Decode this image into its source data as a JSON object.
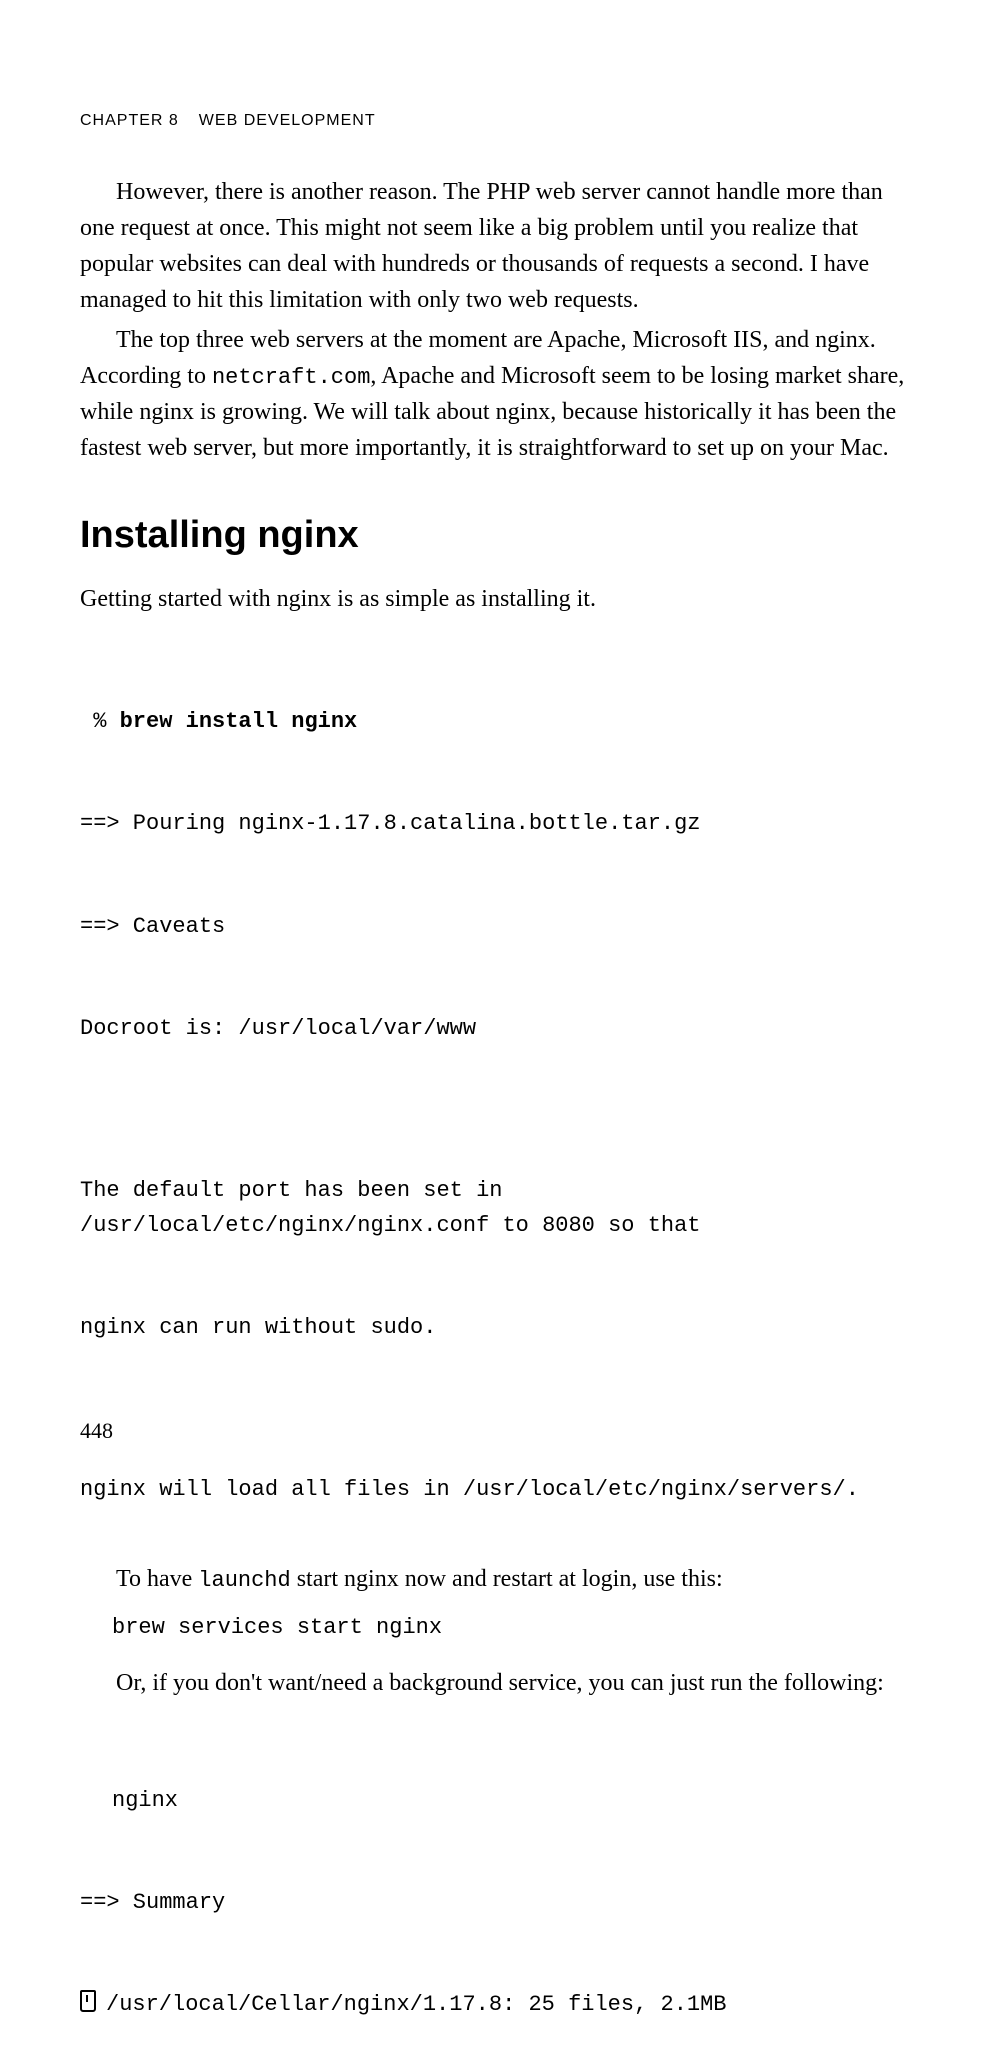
{
  "header": {
    "chapter_label": "Chapter 8",
    "chapter_title": "Web Development"
  },
  "paragraphs": {
    "p1": "However, there is another reason. The PHP web server cannot handle more than one request at once. This might not seem like a big problem until you realize that popular websites can deal with hundreds or thousands of requests a second. I have managed to hit this limitation with only two web requests.",
    "p2a": "The top three web servers at the moment are Apache, Microsoft IIS, and nginx. According to ",
    "p2_code": "netcraft.com",
    "p2b": ", Apache and Microsoft seem to be losing market share, while nginx is growing. We will talk about nginx, because historically it has been the fastest web server, but more importantly, it is straightforward to set up on your Mac."
  },
  "section": {
    "heading": "Installing nginx",
    "intro": "Getting started with nginx is as simple as installing it."
  },
  "terminal": {
    "cmd_prefix": " % ",
    "cmd": "brew install nginx",
    "out1": "==> Pouring nginx-1.17.8.catalina.bottle.tar.gz",
    "out2": "==> Caveats",
    "out3": "Docroot is: /usr/local/var/www",
    "out4": "The default port has been set in /usr/local/etc/nginx/nginx.conf to 8080 so that",
    "out5": "nginx can run without sudo.",
    "out6": "nginx will load all files in /usr/local/etc/nginx/servers/."
  },
  "body2": {
    "p3a": "To have ",
    "p3_code": "launchd",
    "p3b": " start nginx now and restart at login, use this:",
    "code1": "brew services start nginx",
    "p4": "Or, if you don't want/need a background service, you can just run the following:",
    "code2": "nginx",
    "out7": "==> Summary",
    "out8": "/usr/local/Cellar/nginx/1.17.8: 25 files, 2.1MB"
  },
  "page_number": "448"
}
